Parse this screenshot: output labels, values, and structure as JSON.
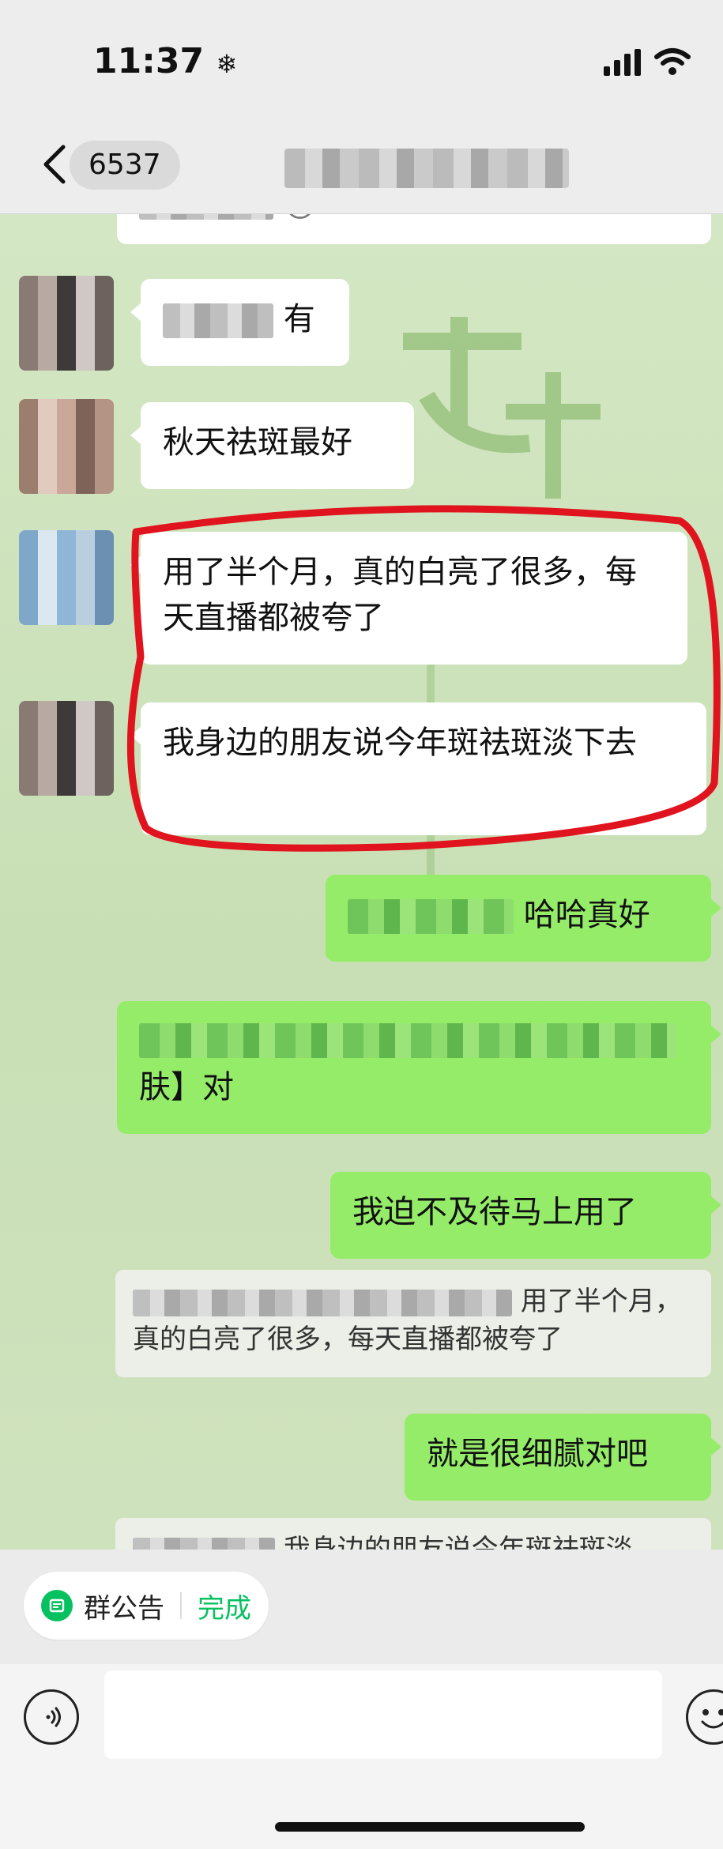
{
  "status": {
    "time": "11:37",
    "time_suffix_icon": "snowflake-icon",
    "signal_icon": "cellular-signal-icon",
    "wifi_icon": "wifi-icon"
  },
  "nav": {
    "back_icon": "chevron-left-icon",
    "unread_count": "6537"
  },
  "messages": {
    "partial_top_emoji": "😉",
    "m1_text": "有",
    "m2_text": "秋天祛斑最好",
    "m3_text": "用了半个月，真的白亮了很多，每天直播都被夸了",
    "m4_text": "我身边的朋友说今年斑祛斑淡下去",
    "m5_text": "哈哈真好",
    "m6_text": "肤】对",
    "m7_text": "我迫不及待马上用了",
    "q1_text": "用了半个月，真的白亮了很多，每天直播都被夸了",
    "m8_text": "就是很细腻对吧",
    "q2_text": "我身边的朋友说今年斑祛斑淡"
  },
  "colors": {
    "outgoing_bubble": "#95ec69",
    "incoming_bubble": "#ffffff",
    "accent": "#07c160",
    "annotation": "#e0141e"
  },
  "announcement": {
    "icon": "announcement-icon",
    "label": "群公告",
    "done": "完成"
  },
  "input": {
    "voice_icon": "voice-icon",
    "emoji_icon": "emoji-icon",
    "placeholder": ""
  }
}
